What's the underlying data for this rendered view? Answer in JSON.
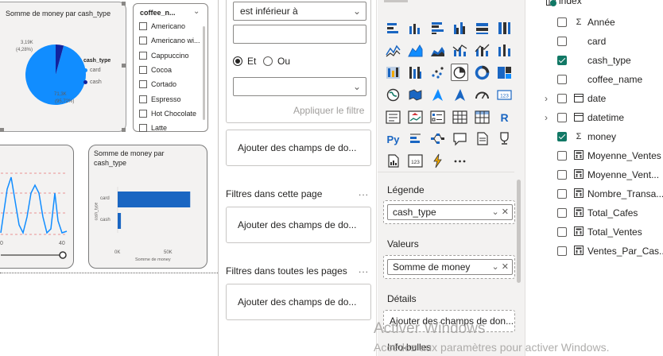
{
  "colors": {
    "accent": "#118dff",
    "dark_series": "#12239e",
    "bar": "#1a66c2",
    "check_green": "#117865",
    "line": "#118dff"
  },
  "canvas": {
    "pie_visual": {
      "title": "Somme de money par cash_type",
      "legend_title": "cash_type",
      "legend_items": [
        {
          "label": "card",
          "color": "#118dff"
        },
        {
          "label": "cash",
          "color": "#12239e"
        }
      ],
      "label_small_value": "3,19K",
      "label_small_pct": "(4,28%)",
      "label_big_value": "71,3K",
      "label_big_pct": "(95,72%)"
    },
    "slicer": {
      "title": "coffee_n...",
      "items": [
        "Americano",
        "Americano wi...",
        "Cappuccino",
        "Cocoa",
        "Cortado",
        "Espresso",
        "Hot Chocolate",
        "Latte"
      ]
    },
    "line_visual": {
      "x_label_left": "0",
      "x_label_right": "40"
    },
    "bar_visual": {
      "title": "Somme de money par cash_type",
      "y_axis_label": "cash_type",
      "x_axis_label": "Somme de money",
      "ticks": [
        "0K",
        "50K"
      ]
    }
  },
  "chart_data": [
    {
      "type": "pie",
      "title": "Somme de money par cash_type",
      "categories": [
        "card",
        "cash"
      ],
      "values": [
        71300,
        3190
      ],
      "percent": [
        95.72,
        4.28
      ]
    },
    {
      "type": "bar",
      "orientation": "horizontal",
      "title": "Somme de money par cash_type",
      "categories": [
        "card",
        "cash"
      ],
      "values": [
        71300,
        3190
      ],
      "xlabel": "Somme de money",
      "ylabel": "cash_type",
      "xlim": [
        0,
        75000
      ],
      "ticks": [
        "0K",
        "50K"
      ]
    }
  ],
  "filters": {
    "condition_select": "est inférieur à",
    "radio_and": "Et",
    "radio_or": "Ou",
    "apply_label": "Appliquer le filtre",
    "add_fields_1": "Ajouter des champs de do...",
    "page_filters_title": "Filtres dans cette page",
    "add_fields_2": "Ajouter des champs de do...",
    "all_pages_title": "Filtres dans toutes les pages",
    "add_fields_3": "Ajouter des champs de do...",
    "more": "..."
  },
  "viz": {
    "more_label": "...",
    "legend_label": "Légende",
    "legend_field": "cash_type",
    "values_label": "Valeurs",
    "values_field": "Somme de money",
    "details_label": "Détails",
    "details_placeholder": "Ajouter des champs de don...",
    "tooltips_label": "Info-bulles",
    "py_label": "Py",
    "r_label": "R",
    "kpi_label": "123"
  },
  "data_pane": {
    "table_name": "index",
    "fields": [
      {
        "name": "Année",
        "icon": "sigma",
        "checked": false,
        "expandable": false
      },
      {
        "name": "card",
        "icon": "none",
        "checked": false,
        "expandable": false
      },
      {
        "name": "cash_type",
        "icon": "none",
        "checked": true,
        "expandable": false
      },
      {
        "name": "coffee_name",
        "icon": "none",
        "checked": false,
        "expandable": false
      },
      {
        "name": "date",
        "icon": "calendar",
        "checked": false,
        "expandable": true
      },
      {
        "name": "datetime",
        "icon": "calendar",
        "checked": false,
        "expandable": true
      },
      {
        "name": "money",
        "icon": "sigma",
        "checked": true,
        "expandable": false
      },
      {
        "name": "Moyenne_Ventes",
        "icon": "calculator",
        "checked": false,
        "expandable": false
      },
      {
        "name": "Moyenne_Vent...",
        "icon": "calculator",
        "checked": false,
        "expandable": false
      },
      {
        "name": "Nombre_Transa...",
        "icon": "calculator",
        "checked": false,
        "expandable": false
      },
      {
        "name": "Total_Cafes",
        "icon": "calculator",
        "checked": false,
        "expandable": false
      },
      {
        "name": "Total_Ventes",
        "icon": "calculator",
        "checked": false,
        "expandable": false
      },
      {
        "name": "Ventes_Par_Cas...",
        "icon": "calculator",
        "checked": false,
        "expandable": false
      }
    ]
  },
  "watermark": {
    "title": "Activer Windows",
    "subtitle": "Accédez aux paramètres pour activer Windows."
  }
}
